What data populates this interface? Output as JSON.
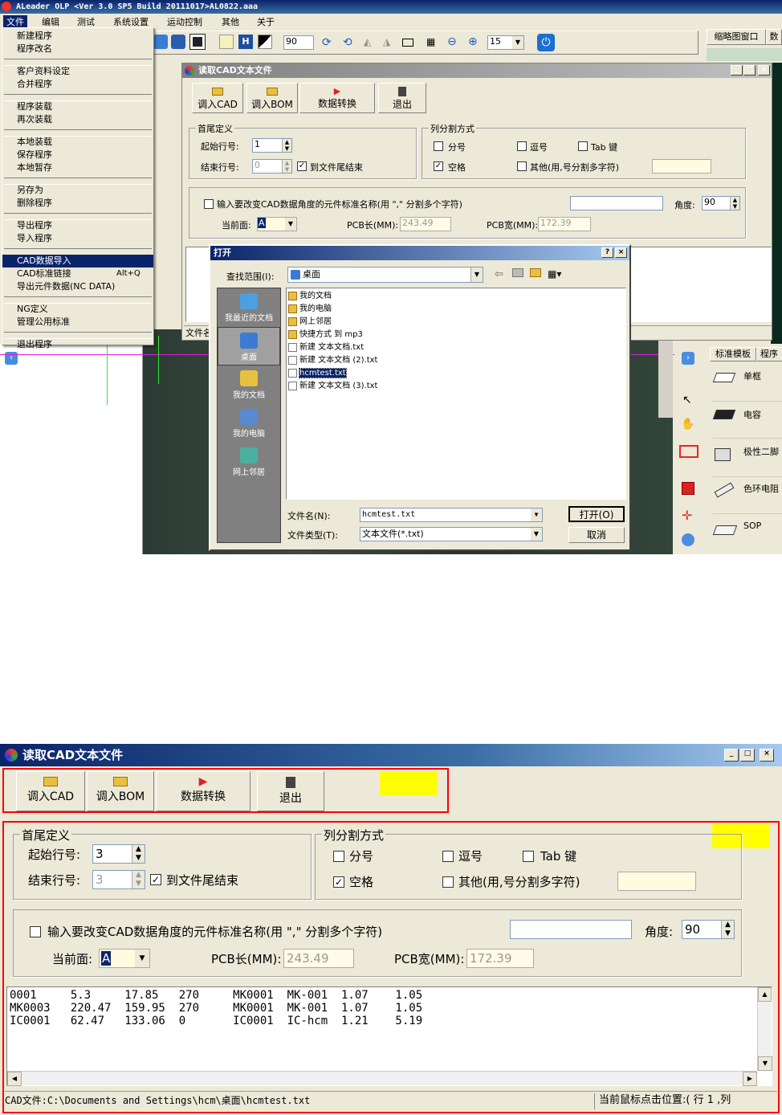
{
  "top": {
    "title": "ALeader OLP  <Ver 3.0 SP5  Build 20111017>AL0822.aaa",
    "menubar": [
      "文件",
      "编辑",
      "测试",
      "系统设置",
      "运动控制",
      "其他",
      "关于"
    ],
    "file_menu": {
      "groups": [
        [
          "新建程序",
          "程序改名"
        ],
        [
          "客户资料设定",
          "合并程序"
        ],
        [
          "程序装载",
          "再次装载"
        ],
        [
          "本地装载",
          "保存程序",
          "本地暂存"
        ],
        [
          "另存为",
          "删除程序"
        ],
        [
          "导出程序",
          "导入程序"
        ],
        [
          "CAD数据导入",
          "CAD标准链接",
          "导出元件数据(NC DATA)"
        ],
        [
          "NG定义",
          "管理公用标准"
        ],
        [
          "退出程序"
        ]
      ],
      "highlighted": "CAD数据导入",
      "shortcut": "Alt+Q"
    },
    "toolbar": {
      "zoom": "90",
      "step": "15"
    },
    "right_panel": {
      "tab1": "缩略图窗口",
      "tab2": "数",
      "lib_tabs": [
        "标准模板",
        "程序"
      ],
      "components": [
        "单框",
        "电容",
        "极性二脚",
        "色环电阻",
        "SOP"
      ]
    },
    "cad_window": {
      "title": "读取CAD文本文件",
      "buttons": [
        "调入CAD",
        "调入BOM",
        "数据转换",
        "退出"
      ],
      "head_group": "首尾定义",
      "start_label": "起始行号:",
      "start_value": "1",
      "end_label": "结束行号:",
      "end_value": "0",
      "to_end": "到文件尾结束",
      "col_group": "列分割方式",
      "semicolon": "分号",
      "comma": "逗号",
      "tab": "Tab 键",
      "space": "空格",
      "other": "其他(用,号分割多字符)",
      "angle_desc": "输入要改变CAD数据角度的元件标准名称(用 \",\" 分割多个字符)",
      "angle_label": "角度:",
      "angle_value": "90",
      "face_label": "当前面:",
      "face_value": "A",
      "pcb_len_label": "PCB长(MM):",
      "pcb_len": "243.49",
      "pcb_wid_label": "PCB宽(MM):",
      "pcb_wid": "172.39",
      "status_left": "文件名"
    },
    "open_dialog": {
      "title": "打开",
      "lookin_label": "查找范围(I):",
      "lookin_value": "桌面",
      "places": [
        "我最近的文档",
        "桌面",
        "我的文档",
        "我的电脑",
        "网上邻居"
      ],
      "files": [
        "我的文档",
        "我的电脑",
        "网上邻居",
        "快捷方式 到 mp3",
        "新建 文本文档.txt",
        "新建 文本文档 (2).txt",
        "hcmtest.txt",
        "新建 文本文档 (3).txt"
      ],
      "selected_file": "hcmtest.txt",
      "filename_label": "文件名(N):",
      "filename_value": "hcmtest.txt",
      "filetype_label": "文件类型(T):",
      "filetype_value": "文本文件(*.txt)",
      "open_btn": "打开(O)",
      "cancel_btn": "取消"
    }
  },
  "bottom": {
    "title": "读取CAD文本文件",
    "buttons": [
      "调入CAD",
      "调入BOM",
      "数据转换",
      "退出"
    ],
    "head_group": "首尾定义",
    "start_label": "起始行号:",
    "start_value": "3",
    "end_label": "结束行号:",
    "end_value": "3",
    "to_end": "到文件尾结束",
    "col_group": "列分割方式",
    "semicolon": "分号",
    "comma": "逗号",
    "tab": "Tab 键",
    "space": "空格",
    "other": "其他(用,号分割多字符)",
    "angle_desc": "输入要改变CAD数据角度的元件标准名称(用 \",\" 分割多个字符)",
    "angle_label": "角度:",
    "angle_value": "90",
    "face_label": "当前面:",
    "face_value": "A",
    "pcb_len_label": "PCB长(MM):",
    "pcb_len": "243.49",
    "pcb_wid_label": "PCB宽(MM):",
    "pcb_wid": "172.39",
    "data_rows": [
      "0001     5.3     17.85   270     MK0001  MK-001  1.07    1.05",
      "MK0003   220.47  159.95  270     MK0001  MK-001  1.07    1.05",
      "IC0001   62.47   133.06  0       IC0001  IC-hcm  1.21    5.19"
    ],
    "status_file": "CAD文件:C:\\Documents and Settings\\hcm\\桌面\\hcmtest.txt",
    "status_pos": "当前鼠标点击位置:( 行 1 ,列"
  },
  "colors": {
    "titlebar": "#0a246a",
    "highlight_box": "#ff0000",
    "marker": "#ffff00",
    "menu_select": "#0a246a"
  }
}
